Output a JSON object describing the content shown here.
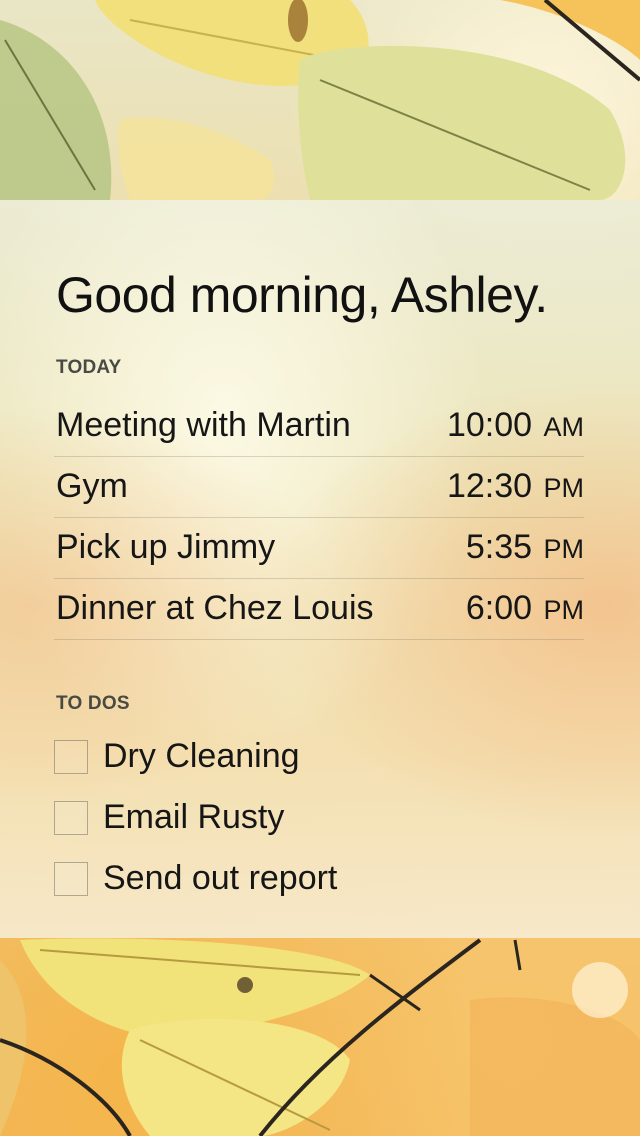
{
  "greeting": "Good morning, Ashley.",
  "today": {
    "label": "TODAY",
    "events": [
      {
        "title": "Meeting with Martin",
        "time": "10:00",
        "ampm": "AM"
      },
      {
        "title": "Gym",
        "time": "12:30",
        "ampm": "PM"
      },
      {
        "title": "Pick up Jimmy",
        "time": "5:35",
        "ampm": "PM"
      },
      {
        "title": "Dinner at Chez Louis",
        "time": "6:00",
        "ampm": "PM"
      }
    ]
  },
  "todos": {
    "label": "TO DOS",
    "items": [
      {
        "label": "Dry Cleaning",
        "checked": false
      },
      {
        "label": "Email Rusty",
        "checked": false
      },
      {
        "label": "Send out report",
        "checked": false
      }
    ]
  },
  "colors": {
    "text": "#161616",
    "section_label": "#4a4a44",
    "leaf_yellow": "#f3e07a",
    "leaf_green": "#b8c88a"
  }
}
